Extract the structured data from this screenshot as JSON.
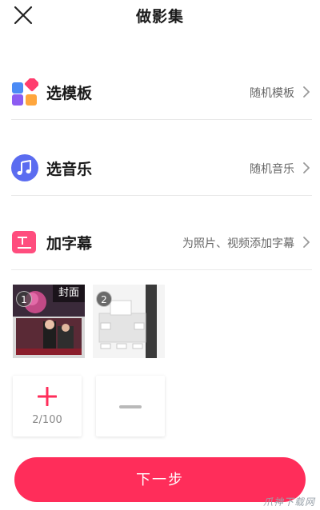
{
  "header": {
    "title": "做影集",
    "close_icon": "close-icon"
  },
  "rows": {
    "template": {
      "label": "选模板",
      "value": "随机模板",
      "icon": "template-grid-icon"
    },
    "music": {
      "label": "选音乐",
      "value": "随机音乐",
      "icon": "music-note-icon"
    },
    "subtitle": {
      "label": "加字幕",
      "value": "为照片、视频添加字幕",
      "icon": "subtitle-icon"
    }
  },
  "thumbnails": [
    {
      "index": "1",
      "badge": "封面"
    },
    {
      "index": "2"
    }
  ],
  "add_tile": {
    "count": "2/100"
  },
  "next_button": {
    "label": "下一步"
  },
  "watermark": "爪神下载网",
  "colors": {
    "accent": "#ff2d5a",
    "music_icon": "#5b6cf0",
    "subtitle_icon": "#ff4d7e",
    "template_blue": "#4b8bf5",
    "template_pink": "#ff3d6e",
    "template_purple": "#8c5cf2",
    "template_orange": "#ffa63d"
  }
}
